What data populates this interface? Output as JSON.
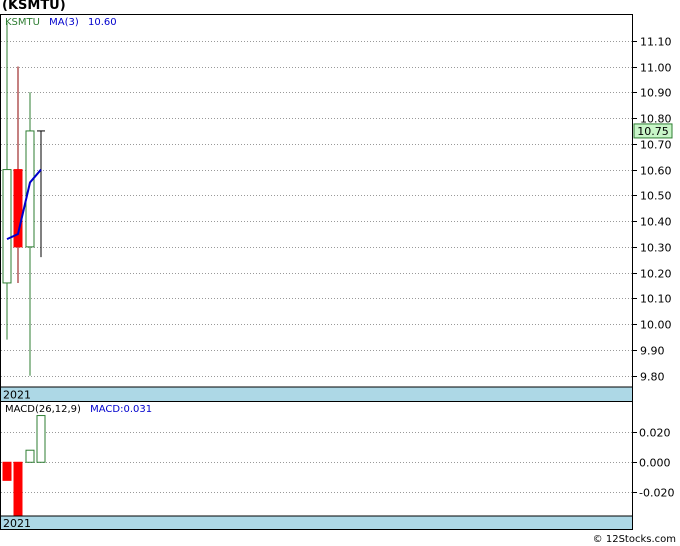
{
  "title": "(KSMTU)",
  "footer": "© 12Stocks.com",
  "colors": {
    "up": "#2e7d32",
    "down": "#ff0000",
    "ma": "#0000cc",
    "band": "#add8e6",
    "grid": "#999999",
    "last_price_bg": "#c8f5c8"
  },
  "price_panel": {
    "legend_symbol": "KSMTU",
    "legend_ma": "MA(3)",
    "legend_ma_value": "10.60",
    "year_label": "2021",
    "last_price_label": "10.75"
  },
  "macd_panel": {
    "legend_name": "MACD(26,12,9)",
    "legend_value": "MACD:0.031",
    "year_label": "2021"
  },
  "chart_data": [
    {
      "type": "candlestick",
      "title": "(KSMTU)",
      "ylim": [
        9.76,
        11.2
      ],
      "y_ticks": [
        "9.80",
        "9.90",
        "10.00",
        "10.10",
        "10.20",
        "10.30",
        "10.40",
        "10.50",
        "10.60",
        "10.70",
        "10.80",
        "10.90",
        "11.00",
        "11.10"
      ],
      "grid": true,
      "candles": [
        {
          "open": 10.16,
          "high": 11.17,
          "low": 9.94,
          "close": 10.6,
          "direction": "up"
        },
        {
          "open": 10.6,
          "high": 11.0,
          "low": 10.16,
          "close": 10.3,
          "direction": "down"
        },
        {
          "open": 10.3,
          "high": 10.9,
          "low": 9.8,
          "close": 10.75,
          "direction": "up"
        },
        {
          "open": 10.75,
          "high": 10.75,
          "low": 10.26,
          "close": 10.75,
          "direction": "doji"
        }
      ],
      "ma3": [
        10.33,
        10.35,
        10.55,
        10.6
      ],
      "last_price": 10.75
    },
    {
      "type": "bar",
      "title": "MACD(26,12,9)",
      "ylim": [
        -0.035,
        0.04
      ],
      "y_ticks": [
        "0.020",
        "0.000",
        "-0.020"
      ],
      "grid": true,
      "values": [
        -0.012,
        -0.035,
        0.008,
        0.031
      ]
    }
  ]
}
